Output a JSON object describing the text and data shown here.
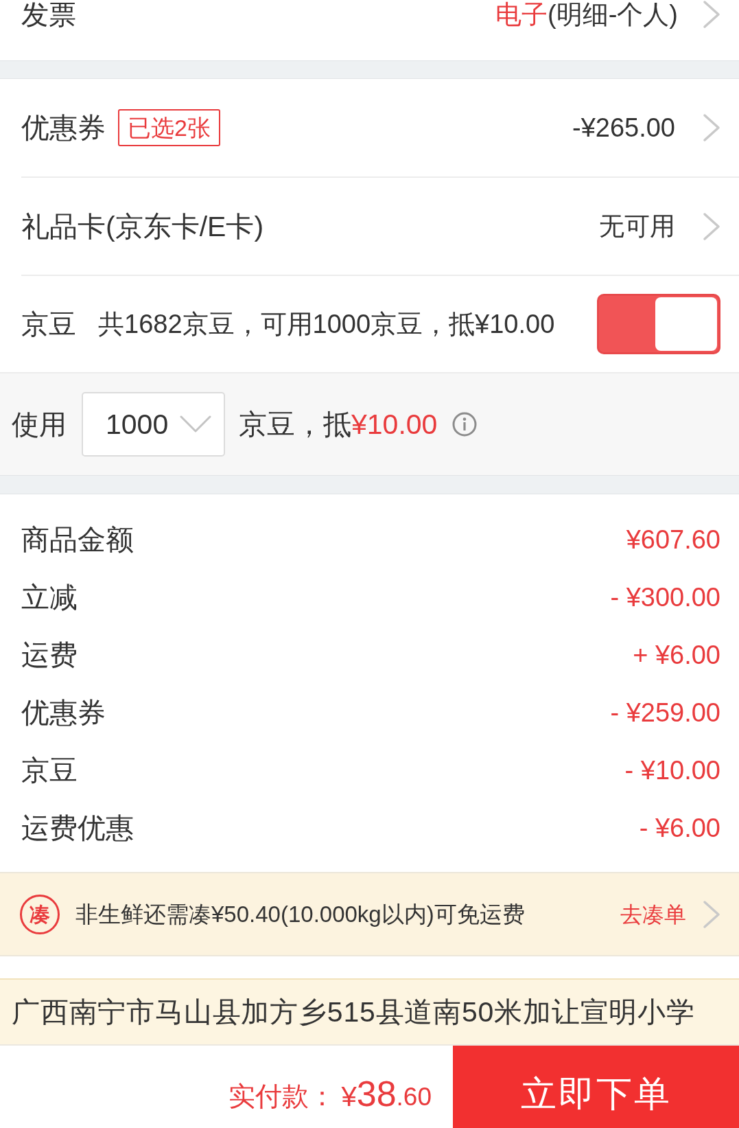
{
  "invoice": {
    "label": "发票",
    "value_type": "电子",
    "value_detail": "(明细-个人)"
  },
  "coupon": {
    "label": "优惠券",
    "badge": "已选2张",
    "value": "-¥265.00"
  },
  "gift_card": {
    "label": "礼品卡(京东卡/E卡)",
    "value": "无可用"
  },
  "jingdou": {
    "label": "京豆",
    "description": "共1682京豆，可用1000京豆，抵¥10.00",
    "on": true
  },
  "jingdou_use": {
    "label": "使用",
    "select_value": "1000",
    "unit_text": "京豆，抵",
    "amount": "¥10.00"
  },
  "summary": [
    {
      "label": "商品金额",
      "value": "¥607.60"
    },
    {
      "label": "立减",
      "value": "- ¥300.00"
    },
    {
      "label": "运费",
      "value": "+ ¥6.00"
    },
    {
      "label": "优惠券",
      "value": "- ¥259.00"
    },
    {
      "label": "京豆",
      "value": "- ¥10.00"
    },
    {
      "label": "运费优惠",
      "value": "- ¥6.00"
    }
  ],
  "free_shipping_tip": {
    "icon_char": "凑",
    "text": "非生鲜还需凑¥50.40(10.000kg以内)可免运费",
    "link": "去凑单"
  },
  "address": "广西南宁市马山县加方乡515县道南50米加让宣明小学",
  "footer": {
    "label": "实付款：",
    "currency": "¥",
    "integer": "38",
    "decimal": ".60",
    "submit": "立即下单"
  }
}
